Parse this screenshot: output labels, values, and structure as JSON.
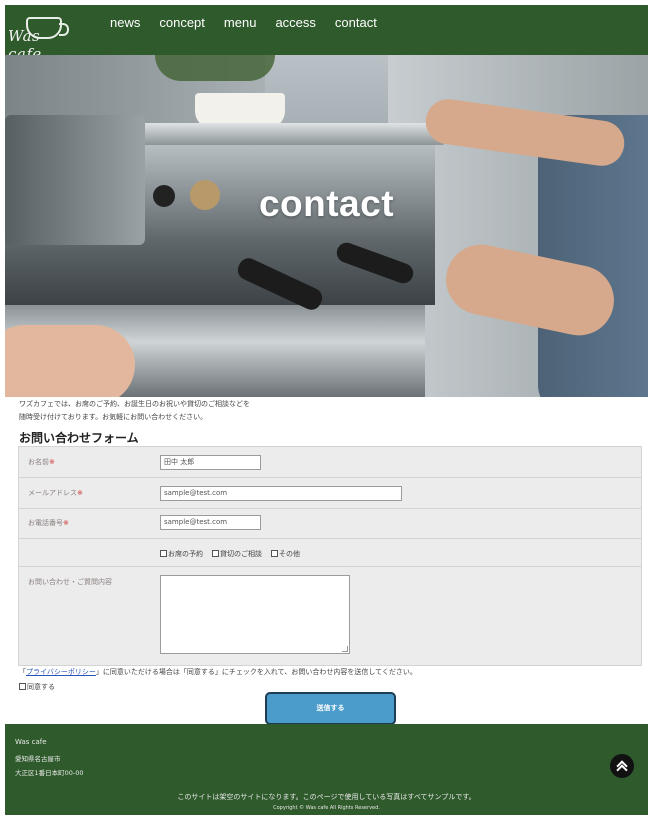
{
  "header": {
    "logo_text": "Was cafe",
    "nav": [
      "news",
      "concept",
      "menu",
      "access",
      "contact"
    ]
  },
  "hero": {
    "title": "contact"
  },
  "intro": {
    "line1": "ワズカフェでは、お席のご予約、お誕生日のお祝いや貸切のご相談などを",
    "line2": "随時受け付けております。お気軽にお問い合わせください。"
  },
  "form": {
    "title": "お問い合わせフォーム",
    "name_label": "お名前",
    "name_value": "田中 太郎",
    "email_label": "メールアドレス",
    "email_value": "sample@test.com",
    "phone_label": "お電話番号",
    "phone_value": "sample@test.com",
    "required_mark": "※",
    "options": [
      "お席の予約",
      "貸切のご相談",
      "その他"
    ],
    "message_label": "お問い合わせ・ご質問内容",
    "message_value": ""
  },
  "policy": {
    "open_bracket": "「",
    "link": "プライバシーポリシー",
    "rest": "」に同意いただける場合は「同意する」にチェックを入れて、お問い合わせ内容を送信してください。"
  },
  "agree_label": "同意する",
  "submit_label": "送信する",
  "footer": {
    "name": "Was cafe",
    "address1": "愛知県名古屋市",
    "address2": "大正区1番日本町00-00",
    "notice": "このサイトは架空のサイトになります。このページで使用している写真はすべてサンプルです。",
    "copyright": "Copyright © Was cafe All Rights Reserved."
  }
}
